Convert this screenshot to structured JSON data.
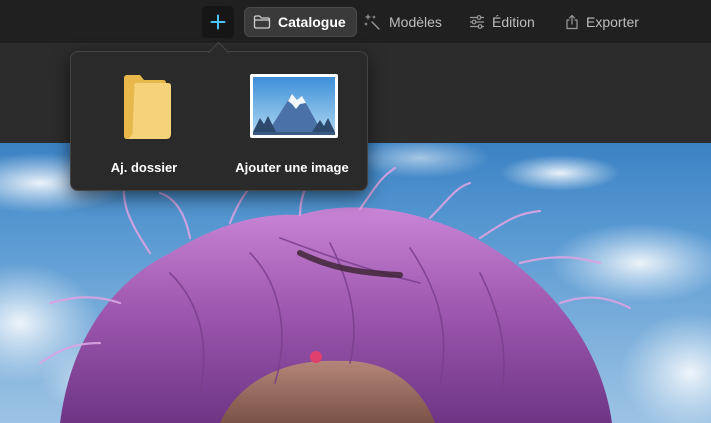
{
  "toolbar": {
    "add_icon": "plus-icon",
    "tabs": [
      {
        "label": "Catalogue",
        "icon": "folder-icon",
        "active": true
      },
      {
        "label": "Modèles",
        "icon": "magic-wand-icon",
        "active": false
      },
      {
        "label": "Édition",
        "icon": "sliders-icon",
        "active": false
      },
      {
        "label": "Exporter",
        "icon": "share-icon",
        "active": false
      }
    ]
  },
  "add_menu": {
    "items": [
      {
        "label": "Aj. dossier",
        "icon": "folder-icon"
      },
      {
        "label": "Ajouter une image",
        "icon": "image-icon"
      }
    ]
  },
  "colors": {
    "accent": "#4cc2ff",
    "toolbar_bg": "#202020",
    "popup_bg": "#2a2a2a"
  }
}
